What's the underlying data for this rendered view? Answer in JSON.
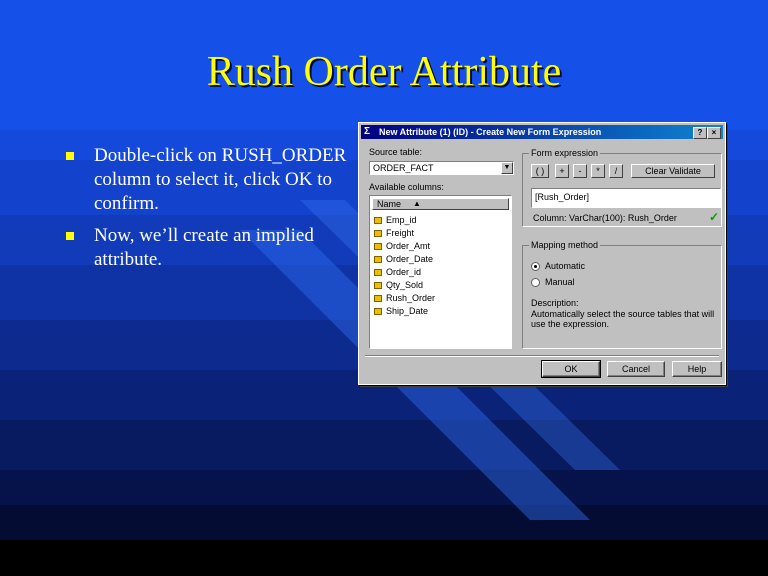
{
  "slide": {
    "title": "Rush Order Attribute",
    "bullets": [
      "Double-click on RUSH_ORDER column to select it, click OK to confirm.",
      "Now, we’ll create an implied attribute."
    ]
  },
  "dialog": {
    "title": "New Attribute (1) (ID) - Create New Form Expression",
    "title_buttons": [
      "?",
      "×"
    ],
    "source_table_label": "Source table:",
    "source_table_value": "ORDER_FACT",
    "available_columns_label": "Available columns:",
    "column_header": "Name",
    "columns": [
      "Emp_id",
      "Freight",
      "Order_Amt",
      "Order_Date",
      "Order_id",
      "Qty_Sold",
      "Rush_Order",
      "Ship_Date"
    ],
    "form_expression": {
      "label": "Form expression",
      "operators": [
        "( )",
        "+",
        "-",
        "*",
        "/"
      ],
      "clear_validate": "Clear   Validate",
      "expression": "[Rush_Order]",
      "status": "Column: VarChar(100): Rush_Order"
    },
    "mapping": {
      "label": "Mapping method",
      "automatic": "Automatic",
      "manual": "Manual",
      "selected": "automatic",
      "description_label": "Description:",
      "description": "Automatically select the source tables that will use the expression."
    },
    "buttons": {
      "ok": "OK",
      "cancel": "Cancel",
      "help": "Help"
    }
  }
}
